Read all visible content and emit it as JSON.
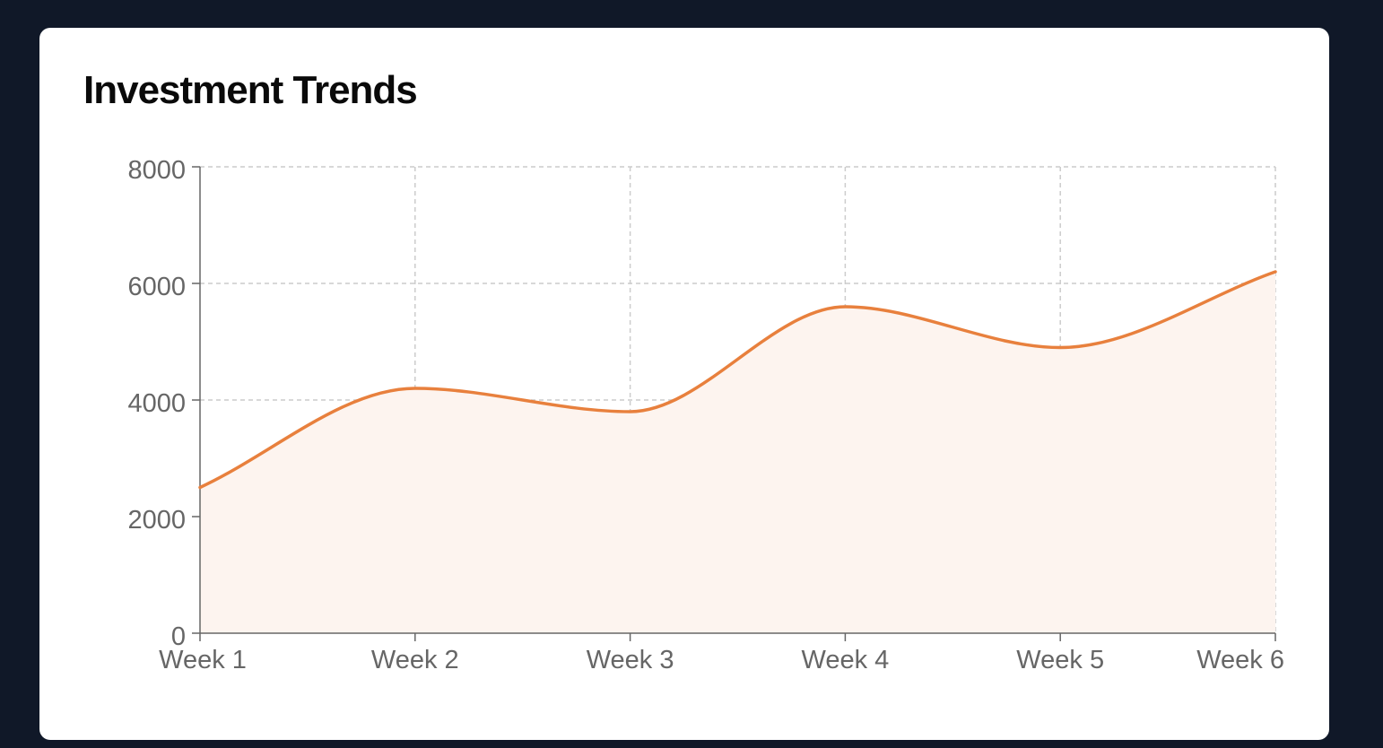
{
  "card": {
    "title": "Investment Trends"
  },
  "colors": {
    "background": "#101828",
    "card": "#ffffff",
    "line": "#e8803d",
    "area": "#fdf4ef",
    "grid": "#cccccc",
    "axis": "#666666"
  },
  "chart_data": {
    "type": "area",
    "title": "Investment Trends",
    "categories": [
      "Week 1",
      "Week 2",
      "Week 3",
      "Week 4",
      "Week 5",
      "Week 6"
    ],
    "series": [
      {
        "values": [
          2500,
          4200,
          3800,
          5600,
          4900,
          6200
        ]
      }
    ],
    "ylim": [
      0,
      8000
    ],
    "yticks": [
      "0",
      "2000",
      "4000",
      "6000",
      "8000"
    ],
    "grid": true,
    "xlabel": "",
    "ylabel": ""
  }
}
